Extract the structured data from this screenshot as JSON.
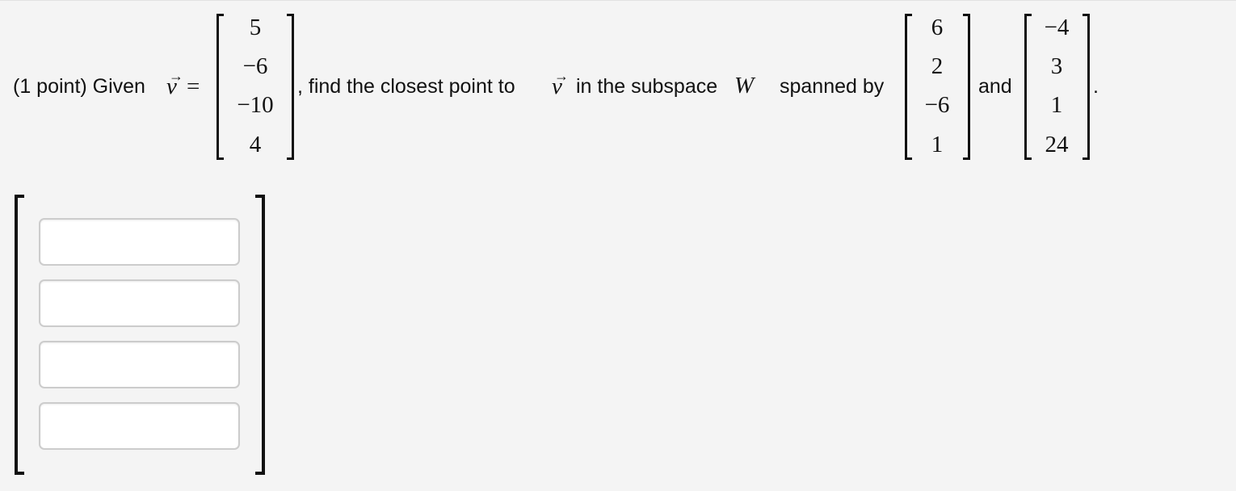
{
  "problem": {
    "points_label": "(1 point) Given",
    "vector_symbol": "v",
    "arrow": "→",
    "equals": "=",
    "vector_v": [
      "5",
      "−6",
      "−10",
      "4"
    ],
    "middle_text": ", find the closest point to",
    "after_v_text": "in the subspace",
    "subspace_symbol": "W",
    "spanned_text": "spanned by",
    "basis_1": [
      "6",
      "2",
      "−6",
      "1"
    ],
    "and_text": "and",
    "basis_2": [
      "−4",
      "3",
      "1",
      "24"
    ],
    "period": "."
  },
  "answer": {
    "inputs": [
      {
        "value": "",
        "placeholder": ""
      },
      {
        "value": "",
        "placeholder": ""
      },
      {
        "value": "",
        "placeholder": ""
      },
      {
        "value": "",
        "placeholder": ""
      }
    ]
  }
}
